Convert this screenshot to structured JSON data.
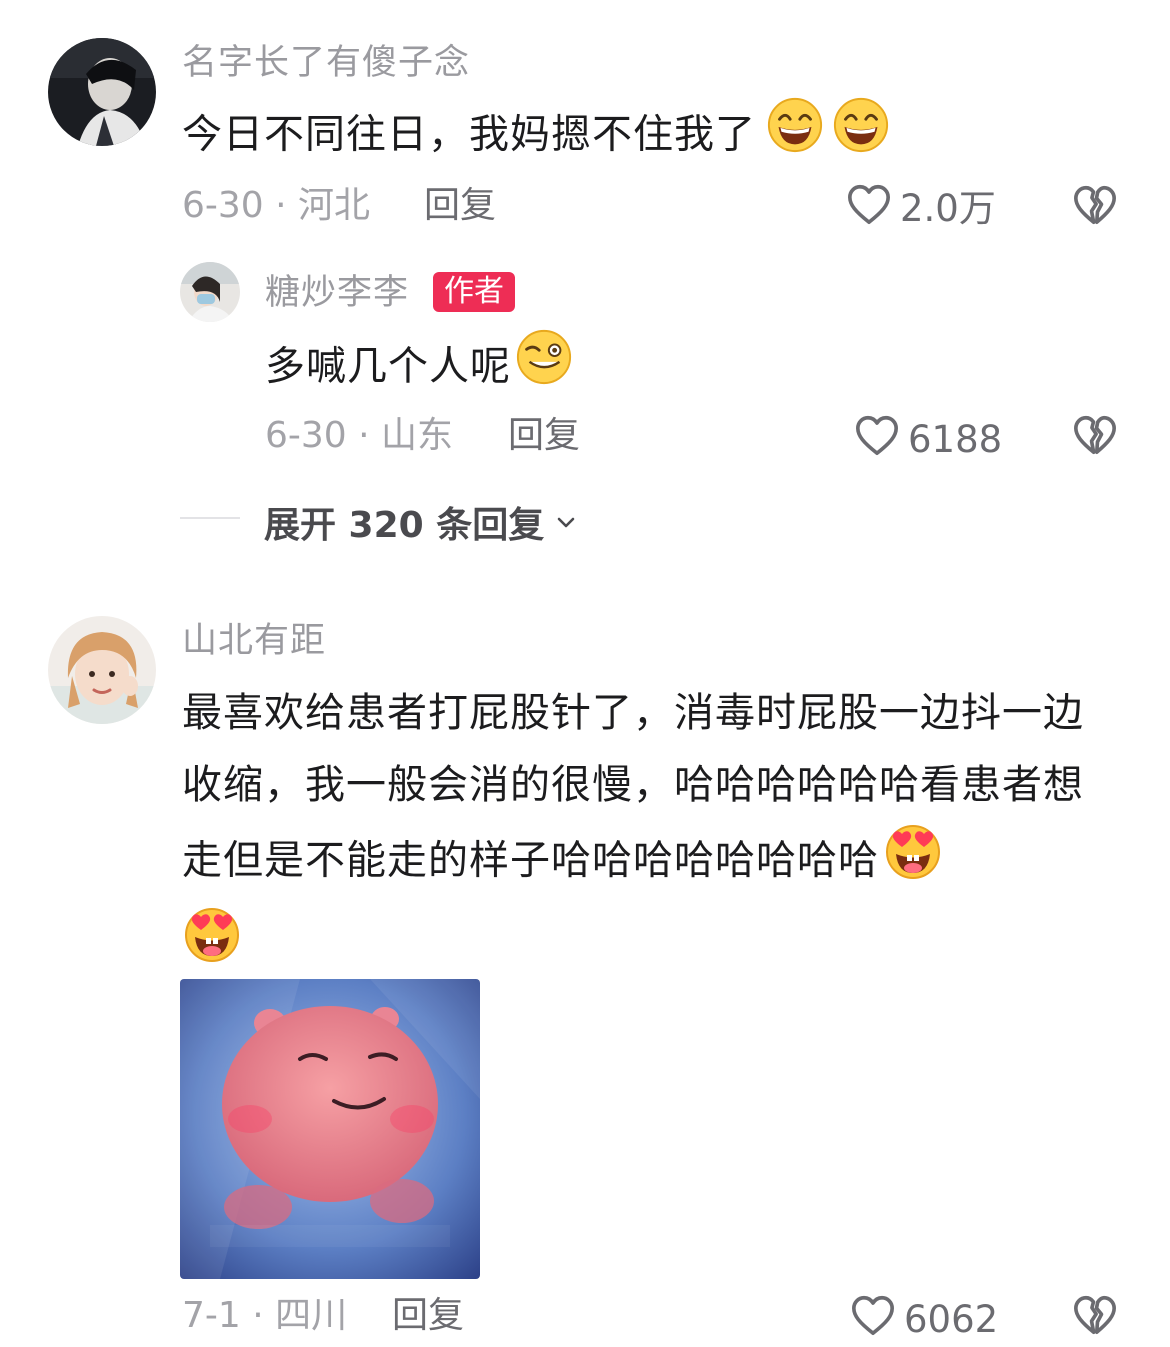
{
  "comments": [
    {
      "username": "名字长了有傻子念",
      "text": "今日不同往日，我妈摁不住我了",
      "date": "6-30",
      "location": "河北",
      "reply_label": "回复",
      "likes": "2.0万",
      "emoji": [
        "grin-squint-emoji",
        "grin-squint-emoji"
      ]
    },
    {
      "username": "糖炒李李",
      "badge": "作者",
      "text": "多喊几个人呢",
      "date": "6-30",
      "location": "山东",
      "reply_label": "回复",
      "likes": "6188",
      "emoji": [
        "smirk-wink-emoji"
      ]
    },
    {
      "username": "山北有距",
      "text": "最喜欢给患者打屁股针了，消毒时屁股一边抖一边收缩，我一般会消的很慢，哈哈哈哈哈哈看患者想走但是不能走的样子哈哈哈哈哈哈哈哈",
      "date": "7-1",
      "location": "四川",
      "reply_label": "回复",
      "likes": "6062",
      "emoji": [
        "heart-eyes-emoji",
        "heart-eyes-emoji"
      ]
    }
  ],
  "expand_replies": "展开 320 条回复",
  "colors": {
    "badge": "#ee2d55",
    "username": "#9a9a9f",
    "text": "#1c1c1e",
    "meta": "#a3a3a8"
  },
  "icons": [
    "heart-outline-icon",
    "broken-heart-icon",
    "chevron-down-icon"
  ]
}
